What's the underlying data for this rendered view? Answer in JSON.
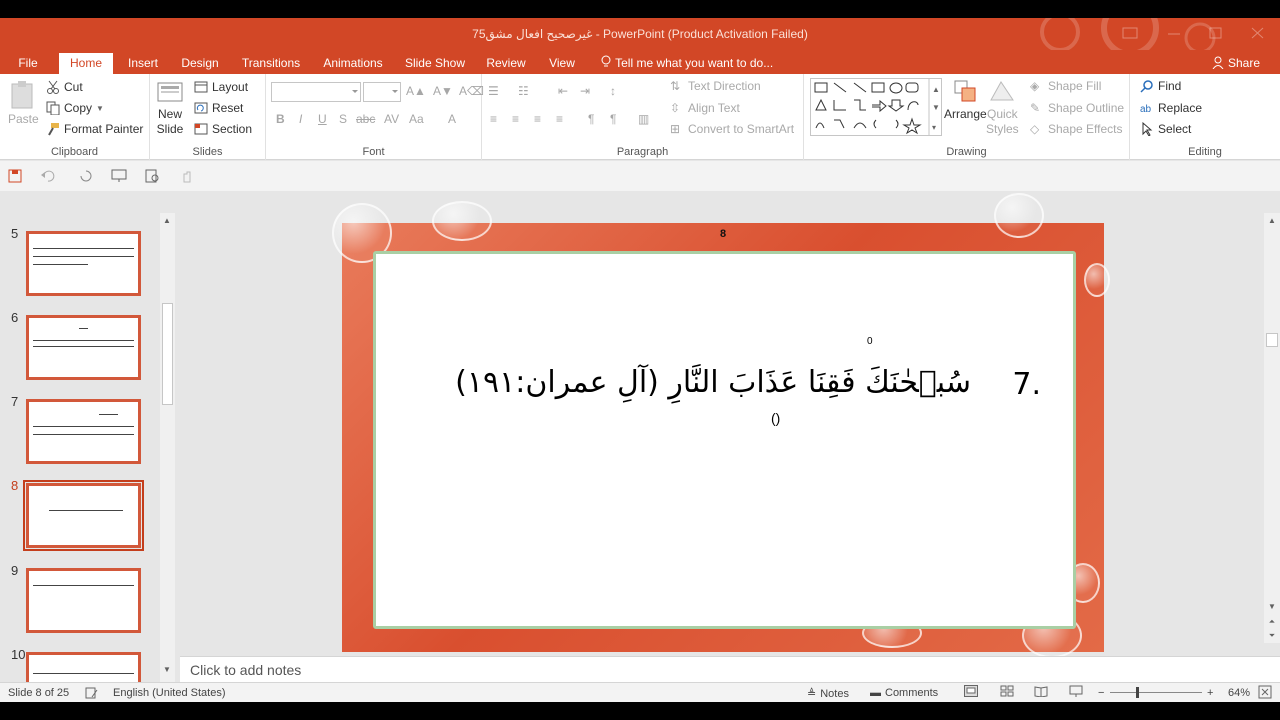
{
  "window": {
    "title": "75غیرصحیح افعال مشق - PowerPoint (Product Activation Failed)",
    "share_label": "Share"
  },
  "tabs": [
    "File",
    "Home",
    "Insert",
    "Design",
    "Transitions",
    "Animations",
    "Slide Show",
    "Review",
    "View"
  ],
  "tell_me": "Tell me what you want to do...",
  "ribbon": {
    "clipboard": {
      "label": "Clipboard",
      "paste": "Paste",
      "cut": "Cut",
      "copy": "Copy",
      "format_painter": "Format Painter"
    },
    "slides": {
      "label": "Slides",
      "new_slide_1": "New",
      "new_slide_2": "Slide",
      "layout": "Layout",
      "reset": "Reset",
      "section": "Section"
    },
    "font": {
      "label": "Font",
      "bold": "B",
      "italic": "I",
      "underline": "U",
      "shadow": "S",
      "strike": "abc",
      "color": "A"
    },
    "paragraph": {
      "label": "Paragraph",
      "text_direction": "Text Direction",
      "align_text": "Align Text",
      "convert_smartart": "Convert to SmartArt"
    },
    "drawing": {
      "label": "Drawing",
      "arrange": "Arrange",
      "quick_styles_1": "Quick",
      "quick_styles_2": "Styles",
      "shape_fill": "Shape Fill",
      "shape_outline": "Shape Outline",
      "shape_effects": "Shape Effects"
    },
    "editing": {
      "label": "Editing",
      "find": "Find",
      "replace": "Replace",
      "select": "Select"
    }
  },
  "thumbnails": [
    {
      "num": "5"
    },
    {
      "num": "6"
    },
    {
      "num": "7"
    },
    {
      "num": "8"
    },
    {
      "num": "9"
    },
    {
      "num": "10"
    }
  ],
  "slide": {
    "number": "8",
    "item_number": "7.",
    "arabic": "سُبۡحٰنَكَ فَقِنَا عَذَابَ النَّارِ (آلِ عمران:۱۹۱)",
    "parens": "()",
    "zero": "0"
  },
  "notes_placeholder": "Click to add notes",
  "status": {
    "slide_of": "Slide 8 of 25",
    "language": "English (United States)",
    "notes": "Notes",
    "comments": "Comments",
    "zoom": "64%"
  },
  "colors": {
    "accent": "#d24726",
    "selected": "#c43e1c"
  }
}
